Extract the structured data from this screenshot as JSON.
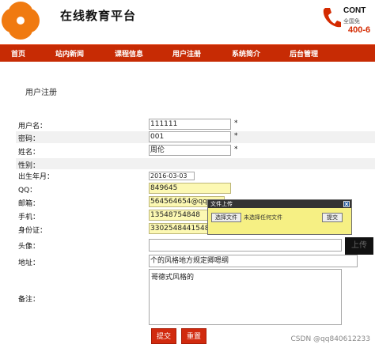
{
  "header": {
    "site_title": "在线教育平台",
    "contact_title": "CONT",
    "contact_sub": "全国免",
    "contact_phone": "400-6"
  },
  "nav": {
    "items": [
      {
        "label": "首页"
      },
      {
        "label": "站内新闻"
      },
      {
        "label": "课程信息"
      },
      {
        "label": "用户注册"
      },
      {
        "label": "系统简介"
      },
      {
        "label": "后台管理"
      }
    ]
  },
  "page": {
    "heading": "用户注册"
  },
  "form": {
    "username": {
      "label": "用户名：",
      "value": "111111",
      "required": "*"
    },
    "password": {
      "label": "密码：",
      "value": "001",
      "required": "*"
    },
    "name": {
      "label": "姓名：",
      "value": "周伦",
      "required": "*"
    },
    "gender": {
      "label": "性别："
    },
    "birthday": {
      "label": "出生年月：",
      "value": "2016-03-03"
    },
    "qq": {
      "label": "QQ：",
      "value": "849645"
    },
    "email": {
      "label": "邮箱：",
      "value": "564564654@qq."
    },
    "phone": {
      "label": "手机：",
      "value": "13548754848"
    },
    "id_card": {
      "label": "身份证：",
      "value": "330254844154848"
    },
    "avatar": {
      "label": "头像：",
      "upload_button": "上传"
    },
    "address": {
      "label": "地址：",
      "value": "个的风格地方规定卿嗯纲"
    },
    "remarks": {
      "label": "备注：",
      "value": "哥德式风格的"
    },
    "submit_label": "提交",
    "reset_label": "重置"
  },
  "upload_dialog": {
    "title": "文件上传",
    "choose_label": "选择文件",
    "no_file_text": "未选择任何文件",
    "submit_label": "提交"
  },
  "watermark": "CSDN @qq840612233",
  "colors": {
    "nav_bg": "#c72b04",
    "logo_orange": "#f07a10",
    "highlight_field": "#fcf8b3",
    "button_red": "#d12a0e"
  }
}
